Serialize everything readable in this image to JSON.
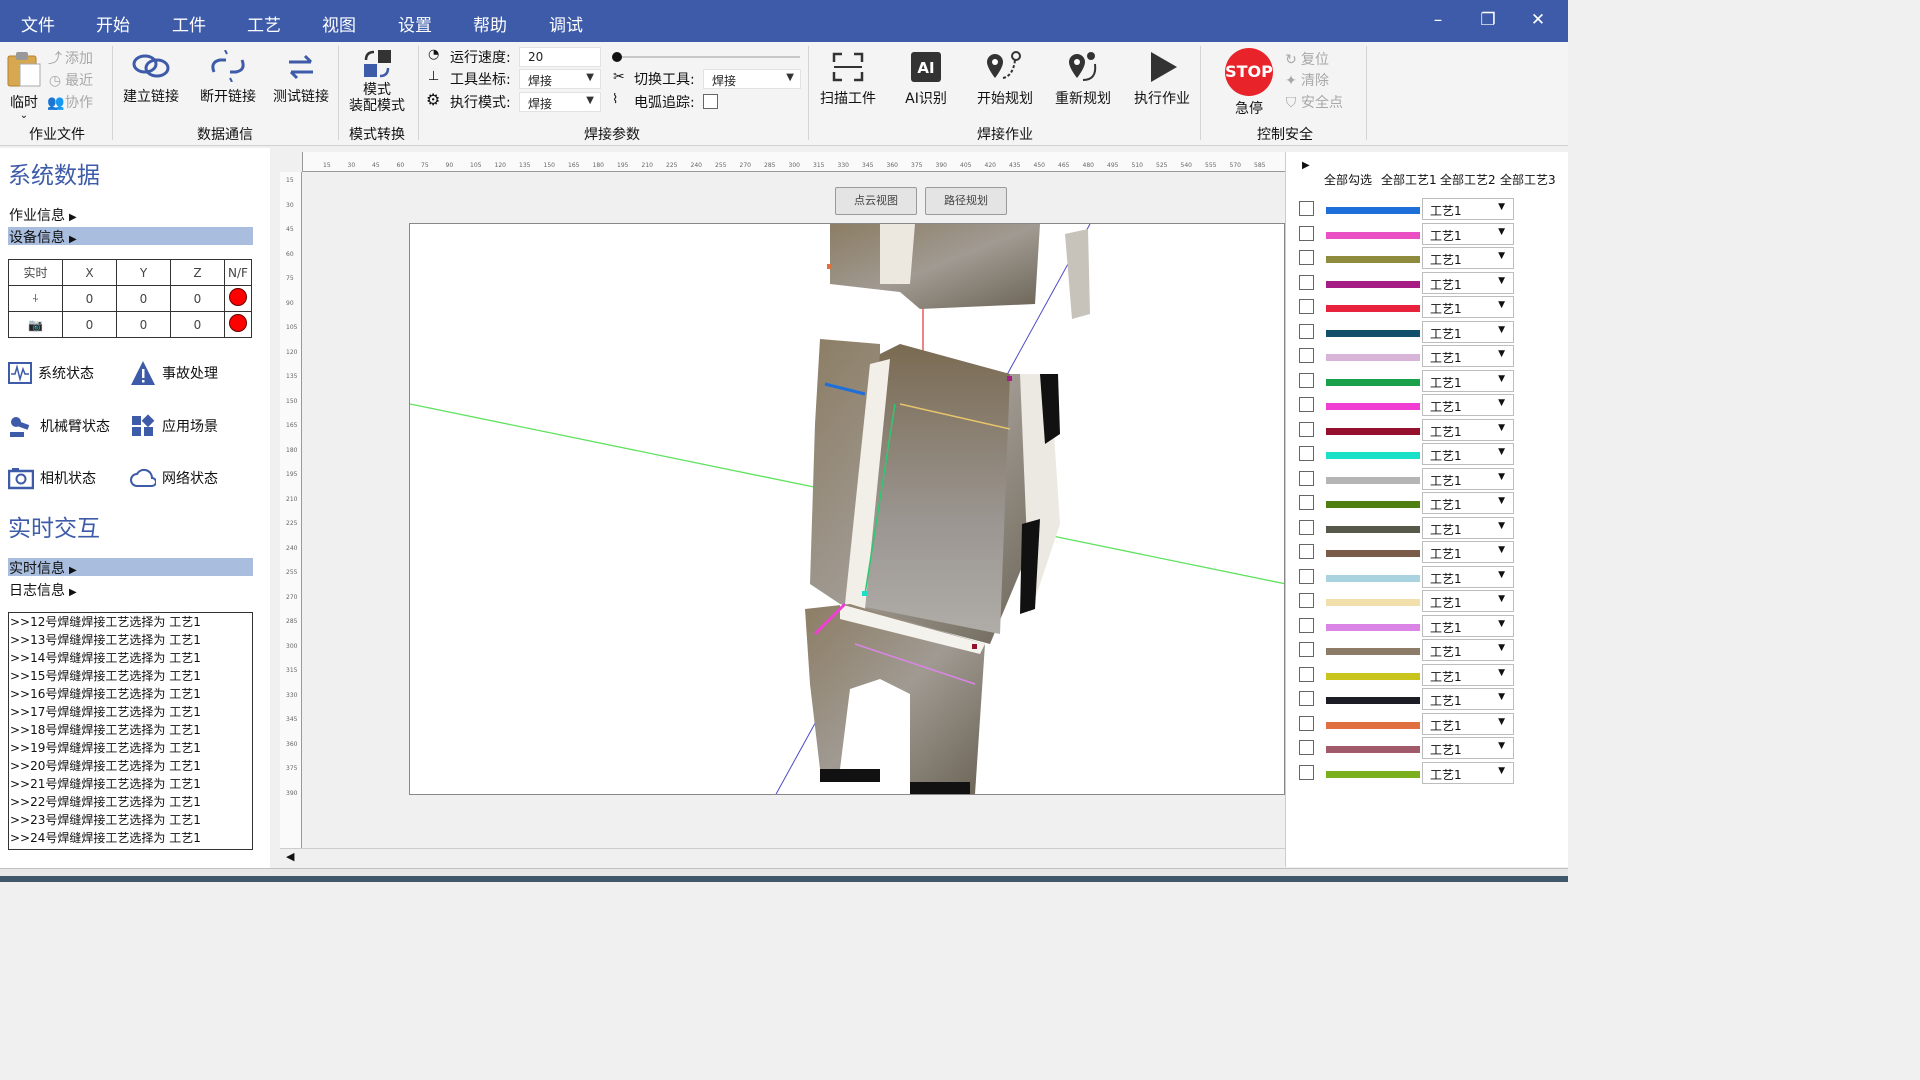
{
  "menu": [
    "文件",
    "开始",
    "工件",
    "工艺",
    "视图",
    "设置",
    "帮助",
    "调试"
  ],
  "window_controls": {
    "minimize": "–",
    "restore": "❐",
    "close": "✕"
  },
  "ribbon": {
    "job_files": {
      "temp_label": "临时",
      "add": "添加",
      "recent": "最近",
      "collab": "协作",
      "group": "作业文件"
    },
    "data_comm": {
      "connect": "建立链接",
      "disconnect": "断开链接",
      "test": "测试链接",
      "group": "数据通信"
    },
    "mode_switch": {
      "label_line1": "模式",
      "label_line2": "装配模式",
      "group": "模式转换"
    },
    "weld_params": {
      "speed_label": "运行速度:",
      "speed_value": "20",
      "tool_coord_label": "工具坐标:",
      "tool_coord_value": "焊接",
      "exec_mode_label": "执行模式:",
      "exec_mode_value": "焊接",
      "switch_tool_label": "切换工具:",
      "switch_tool_value": "焊接",
      "arc_track_label": "电弧追踪:",
      "speed_slider_fraction": 0.0,
      "group": "焊接参数"
    },
    "weld_job": {
      "scan": "扫描工件",
      "ai": "AI识别",
      "plan": "开始规划",
      "replan": "重新规划",
      "execute": "执行作业",
      "group": "焊接作业"
    },
    "control": {
      "stop_text": "STOP",
      "estop": "急停",
      "reset": "复位",
      "clear": "清除",
      "safe_point": "安全点",
      "group": "控制安全"
    }
  },
  "left": {
    "system_data_title": "系统数据",
    "job_info": "作业信息",
    "device_info": "设备信息",
    "table_headers": [
      "实时",
      "X",
      "Y",
      "Z",
      "N/F"
    ],
    "table_rows": [
      {
        "icon": "welding-torch-icon",
        "x": "0",
        "y": "0",
        "z": "0",
        "status_color": "#ff0000"
      },
      {
        "icon": "camera-icon",
        "x": "0",
        "y": "0",
        "z": "0",
        "status_color": "#ff0000"
      }
    ],
    "status_items": [
      "系统状态",
      "事故处理",
      "机械臂状态",
      "应用场景",
      "相机状态",
      "网络状态"
    ],
    "realtime_title": "实时交互",
    "realtime_info": "实时信息",
    "log_info": "日志信息",
    "log_lines": [
      ">>12号焊缝焊接工艺选择为 工艺1",
      ">>13号焊缝焊接工艺选择为 工艺1",
      ">>14号焊缝焊接工艺选择为 工艺1",
      ">>15号焊缝焊接工艺选择为 工艺1",
      ">>16号焊缝焊接工艺选择为 工艺1",
      ">>17号焊缝焊接工艺选择为 工艺1",
      ">>18号焊缝焊接工艺选择为 工艺1",
      ">>19号焊缝焊接工艺选择为 工艺1",
      ">>20号焊缝焊接工艺选择为 工艺1",
      ">>21号焊缝焊接工艺选择为 工艺1",
      ">>22号焊缝焊接工艺选择为 工艺1",
      ">>23号焊缝焊接工艺选择为 工艺1",
      ">>24号焊缝焊接工艺选择为 工艺1"
    ]
  },
  "center": {
    "view_buttons": [
      "点云视图",
      "路径规划"
    ],
    "ruler_top": [
      "15",
      "30",
      "45",
      "60",
      "75",
      "90",
      "105",
      "120",
      "135",
      "150",
      "165",
      "180",
      "195",
      "210",
      "225",
      "240",
      "255",
      "270",
      "285",
      "300",
      "315",
      "330",
      "345",
      "360",
      "375",
      "390",
      "405",
      "420",
      "435",
      "450",
      "465",
      "480",
      "495",
      "510",
      "525",
      "540",
      "555",
      "570",
      "585"
    ],
    "ruler_left": [
      "15",
      "30",
      "45",
      "60",
      "75",
      "90",
      "105",
      "120",
      "135",
      "150",
      "165",
      "180",
      "195",
      "210",
      "225",
      "240",
      "255",
      "270",
      "285",
      "300",
      "315",
      "330",
      "345",
      "360",
      "375",
      "390"
    ]
  },
  "right": {
    "headers": [
      "全部勾选",
      "全部工艺1",
      "全部工艺2",
      "全部工艺3"
    ],
    "rows": [
      {
        "color": "#1e6fd9",
        "process": "工艺1"
      },
      {
        "color": "#ea4fc4",
        "process": "工艺1"
      },
      {
        "color": "#8e8a3e",
        "process": "工艺1"
      },
      {
        "color": "#a51c84",
        "process": "工艺1"
      },
      {
        "color": "#e8223c",
        "process": "工艺1"
      },
      {
        "color": "#124f6b",
        "process": "工艺1"
      },
      {
        "color": "#d8b4d8",
        "process": "工艺1"
      },
      {
        "color": "#19a04a",
        "process": "工艺1"
      },
      {
        "color": "#f03ed2",
        "process": "工艺1"
      },
      {
        "color": "#95102e",
        "process": "工艺1"
      },
      {
        "color": "#19e0c6",
        "process": "工艺1"
      },
      {
        "color": "#b5b5b5",
        "process": "工艺1"
      },
      {
        "color": "#4f7f12",
        "process": "工艺1"
      },
      {
        "color": "#56584a",
        "process": "工艺1"
      },
      {
        "color": "#7a5a49",
        "process": "工艺1"
      },
      {
        "color": "#a9d4df",
        "process": "工艺1"
      },
      {
        "color": "#f1e0ab",
        "process": "工艺1"
      },
      {
        "color": "#da85e6",
        "process": "工艺1"
      },
      {
        "color": "#8c7b66",
        "process": "工艺1"
      },
      {
        "color": "#c8c41c",
        "process": "工艺1"
      },
      {
        "color": "#1c1c24",
        "process": "工艺1"
      },
      {
        "color": "#e07040",
        "process": "工艺1"
      },
      {
        "color": "#a05a6a",
        "process": "工艺1"
      },
      {
        "color": "#7ab01e",
        "process": "工艺1"
      }
    ]
  }
}
